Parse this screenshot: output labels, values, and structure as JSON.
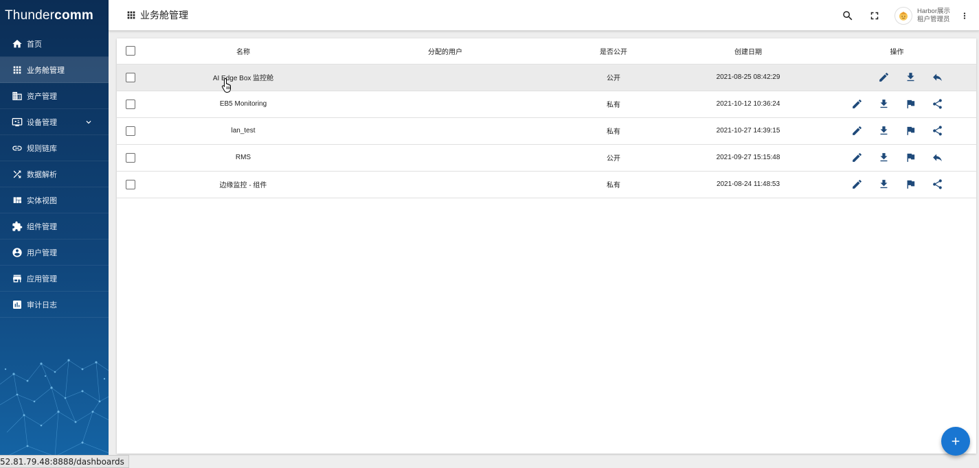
{
  "logo": {
    "thin": "Thunder",
    "bold": "comm"
  },
  "sidebar": {
    "items": [
      {
        "label": "首页",
        "icon": "home-icon"
      },
      {
        "label": "业务舱管理",
        "icon": "apps-grid-icon"
      },
      {
        "label": "资产管理",
        "icon": "building-icon"
      },
      {
        "label": "设备管理",
        "icon": "devices-icon"
      },
      {
        "label": "规则链库",
        "icon": "link-icon"
      },
      {
        "label": "数据解析",
        "icon": "shuffle-icon"
      },
      {
        "label": "实体视图",
        "icon": "view-quilt-icon"
      },
      {
        "label": "组件管理",
        "icon": "puzzle-icon"
      },
      {
        "label": "用户管理",
        "icon": "account-circle-icon"
      },
      {
        "label": "应用管理",
        "icon": "store-icon"
      },
      {
        "label": "审计日志",
        "icon": "bar-chart-icon"
      }
    ],
    "active_index": 1
  },
  "header": {
    "title": "业务舱管理",
    "user_name": "Harbor展示",
    "user_role": "租户管理员"
  },
  "table": {
    "columns": [
      "名称",
      "分配的用户",
      "是否公开",
      "创建日期",
      "操作"
    ],
    "rows": [
      {
        "name": "AI Edge Box 监控舱",
        "assigned": "",
        "public": "公开",
        "created": "2021-08-25 08:42:29",
        "actions": [
          "edit",
          "download",
          "unshare"
        ]
      },
      {
        "name": "EB5 Monitoring",
        "assigned": "",
        "public": "私有",
        "created": "2021-10-12 10:36:24",
        "actions": [
          "edit",
          "download",
          "assign",
          "share"
        ]
      },
      {
        "name": "lan_test",
        "assigned": "",
        "public": "私有",
        "created": "2021-10-27 14:39:15",
        "actions": [
          "edit",
          "download",
          "assign",
          "share"
        ]
      },
      {
        "name": "RMS",
        "assigned": "",
        "public": "公开",
        "created": "2021-09-27 15:15:48",
        "actions": [
          "edit",
          "download",
          "assign",
          "unshare"
        ]
      },
      {
        "name": "边缘监控 - 组件",
        "assigned": "",
        "public": "私有",
        "created": "2021-08-24 11:48:53",
        "actions": [
          "edit",
          "download",
          "assign",
          "share"
        ]
      }
    ]
  },
  "status_bar": {
    "url": "52.81.79.48:8888/dashboards"
  },
  "colors": {
    "sidebar_top": "#0b2d55",
    "sidebar_bottom": "#1565a6",
    "fab": "#1976d2",
    "action_icon": "#1f4a7a"
  }
}
